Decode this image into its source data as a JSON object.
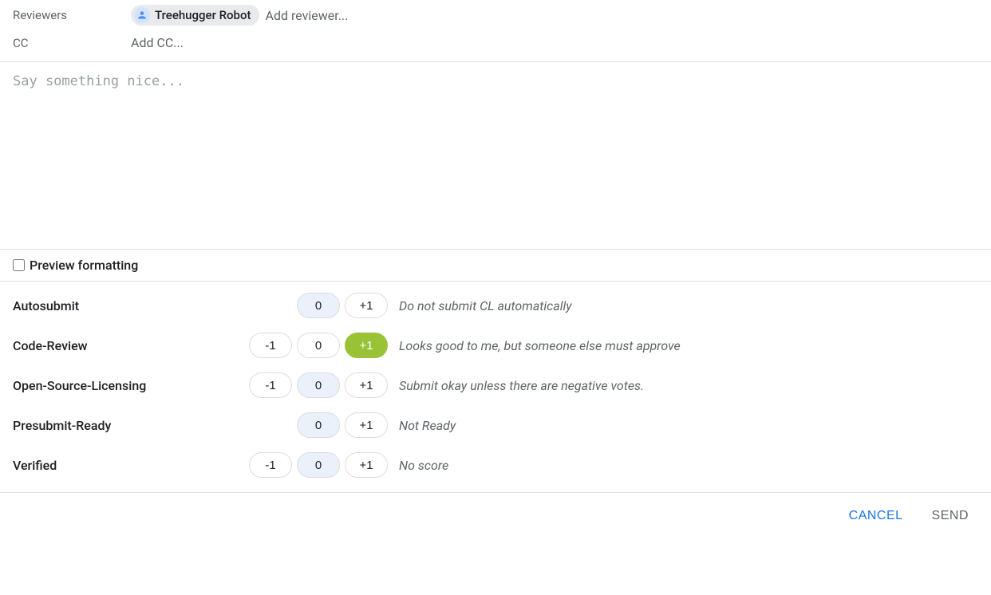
{
  "header": {
    "reviewers_label": "Reviewers",
    "cc_label": "CC",
    "reviewer_chip_name": "Treehugger Robot",
    "add_reviewer_placeholder": "Add reviewer...",
    "add_cc_placeholder": "Add CC..."
  },
  "comment": {
    "placeholder": "Say something nice..."
  },
  "preview": {
    "label": "Preview formatting",
    "checked": false
  },
  "labels": [
    {
      "name": "Autosubmit",
      "votes": [
        "0",
        "+1"
      ],
      "selected": "0",
      "selected_state": "neutral",
      "description": "Do not submit CL automatically"
    },
    {
      "name": "Code-Review",
      "votes": [
        "-1",
        "0",
        "+1"
      ],
      "selected": "+1",
      "selected_state": "positive",
      "description": "Looks good to me, but someone else must approve"
    },
    {
      "name": "Open-Source-Licensing",
      "votes": [
        "-1",
        "0",
        "+1"
      ],
      "selected": "0",
      "selected_state": "neutral",
      "description": "Submit okay unless there are negative votes."
    },
    {
      "name": "Presubmit-Ready",
      "votes": [
        "0",
        "+1"
      ],
      "selected": "0",
      "selected_state": "neutral",
      "description": "Not Ready"
    },
    {
      "name": "Verified",
      "votes": [
        "-1",
        "0",
        "+1"
      ],
      "selected": "0",
      "selected_state": "neutral",
      "description": "No score"
    }
  ],
  "actions": {
    "cancel": "CANCEL",
    "send": "SEND"
  }
}
